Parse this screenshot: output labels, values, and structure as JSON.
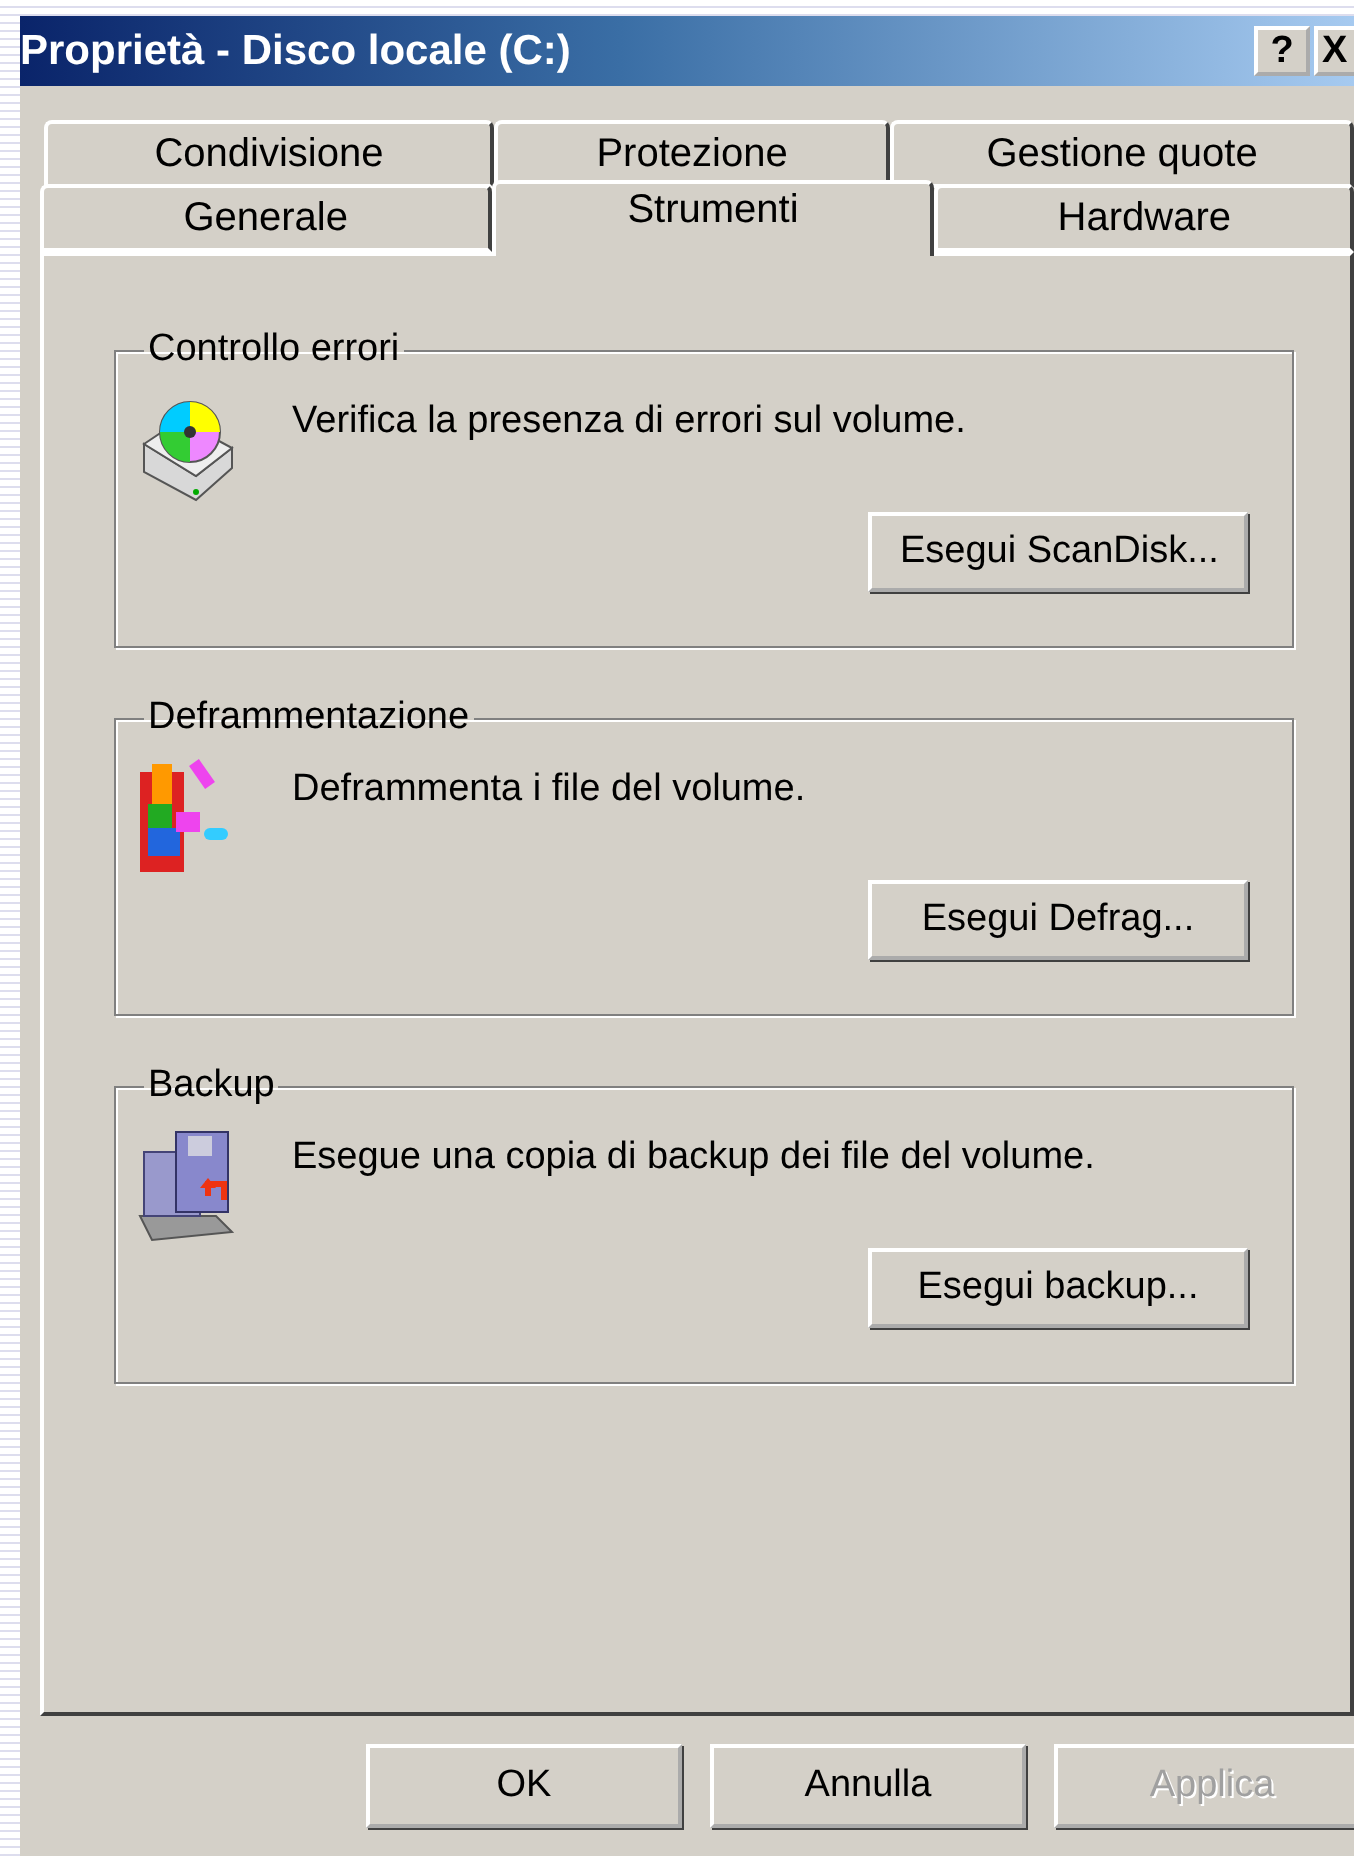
{
  "window": {
    "title": "Proprietà - Disco locale (C:)",
    "help_button": "?",
    "close_button": "X"
  },
  "tab_rows": [
    [
      {
        "label": "Condivisione",
        "selected": false
      },
      {
        "label": "Protezione",
        "selected": false
      },
      {
        "label": "Gestione quote",
        "selected": false
      }
    ],
    [
      {
        "label": "Generale",
        "selected": false
      },
      {
        "label": "Strumenti",
        "selected": true
      },
      {
        "label": "Hardware",
        "selected": false
      }
    ]
  ],
  "groups": [
    {
      "title": "Controllo errori",
      "kind": "scandisk",
      "description": "Verifica la presenza di errori sul volume.",
      "button": "Esegui ScanDisk..."
    },
    {
      "title": "Deframmentazione",
      "kind": "defrag",
      "description": "Deframmenta i file del volume.",
      "button": "Esegui Defrag..."
    },
    {
      "title": "Backup",
      "kind": "backup",
      "description": "Esegue una copia di backup dei file del volume.",
      "button": "Esegui backup..."
    }
  ],
  "buttons": [
    {
      "label": "OK",
      "disabled": false
    },
    {
      "label": "Annulla",
      "disabled": false
    },
    {
      "label": "Applica",
      "disabled": true
    }
  ]
}
